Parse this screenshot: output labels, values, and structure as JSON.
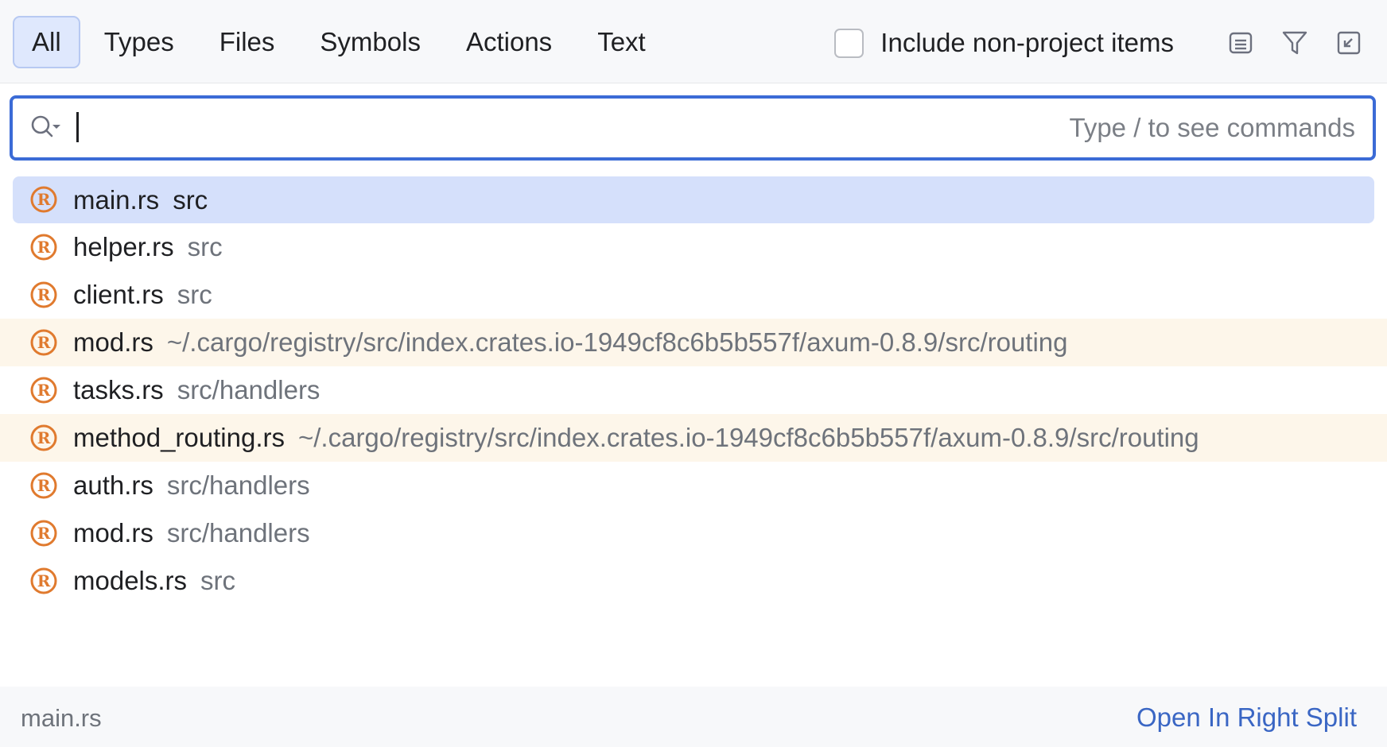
{
  "tabs": [
    {
      "label": "All",
      "active": true
    },
    {
      "label": "Types",
      "active": false
    },
    {
      "label": "Files",
      "active": false
    },
    {
      "label": "Symbols",
      "active": false
    },
    {
      "label": "Actions",
      "active": false
    },
    {
      "label": "Text",
      "active": false
    }
  ],
  "options": {
    "include_non_project_label": "Include non-project items",
    "include_non_project_checked": false,
    "icons": [
      "preview-icon",
      "filter-icon",
      "open-in-tool-window-icon"
    ]
  },
  "search": {
    "value": "",
    "hint": "Type / to see commands"
  },
  "results": [
    {
      "name": "main.rs",
      "location": "src",
      "selected": true,
      "external": false,
      "icon": "rust-file-icon"
    },
    {
      "name": "helper.rs",
      "location": "src",
      "selected": false,
      "external": false,
      "icon": "rust-file-icon"
    },
    {
      "name": "client.rs",
      "location": "src",
      "selected": false,
      "external": false,
      "icon": "rust-file-icon"
    },
    {
      "name": "mod.rs",
      "location": "~/.cargo/registry/src/index.crates.io-1949cf8c6b5b557f/axum-0.8.9/src/routing",
      "selected": false,
      "external": true,
      "icon": "rust-file-icon"
    },
    {
      "name": "tasks.rs",
      "location": "src/handlers",
      "selected": false,
      "external": false,
      "icon": "rust-file-icon"
    },
    {
      "name": "method_routing.rs",
      "location": "~/.cargo/registry/src/index.crates.io-1949cf8c6b5b557f/axum-0.8.9/src/routing",
      "selected": false,
      "external": true,
      "icon": "rust-file-icon"
    },
    {
      "name": "auth.rs",
      "location": "src/handlers",
      "selected": false,
      "external": false,
      "icon": "rust-file-icon"
    },
    {
      "name": "mod.rs",
      "location": "src/handlers",
      "selected": false,
      "external": false,
      "icon": "rust-file-icon"
    },
    {
      "name": "models.rs",
      "location": "src",
      "selected": false,
      "external": false,
      "icon": "rust-file-icon"
    }
  ],
  "footer": {
    "path": "main.rs",
    "action_label": "Open In Right Split"
  },
  "colors": {
    "accent": "#3b6bd6",
    "selection": "#d5e0fb",
    "external_row": "#fdf6ea",
    "rust_icon": "#e07a2e",
    "link": "#3a66c4"
  }
}
